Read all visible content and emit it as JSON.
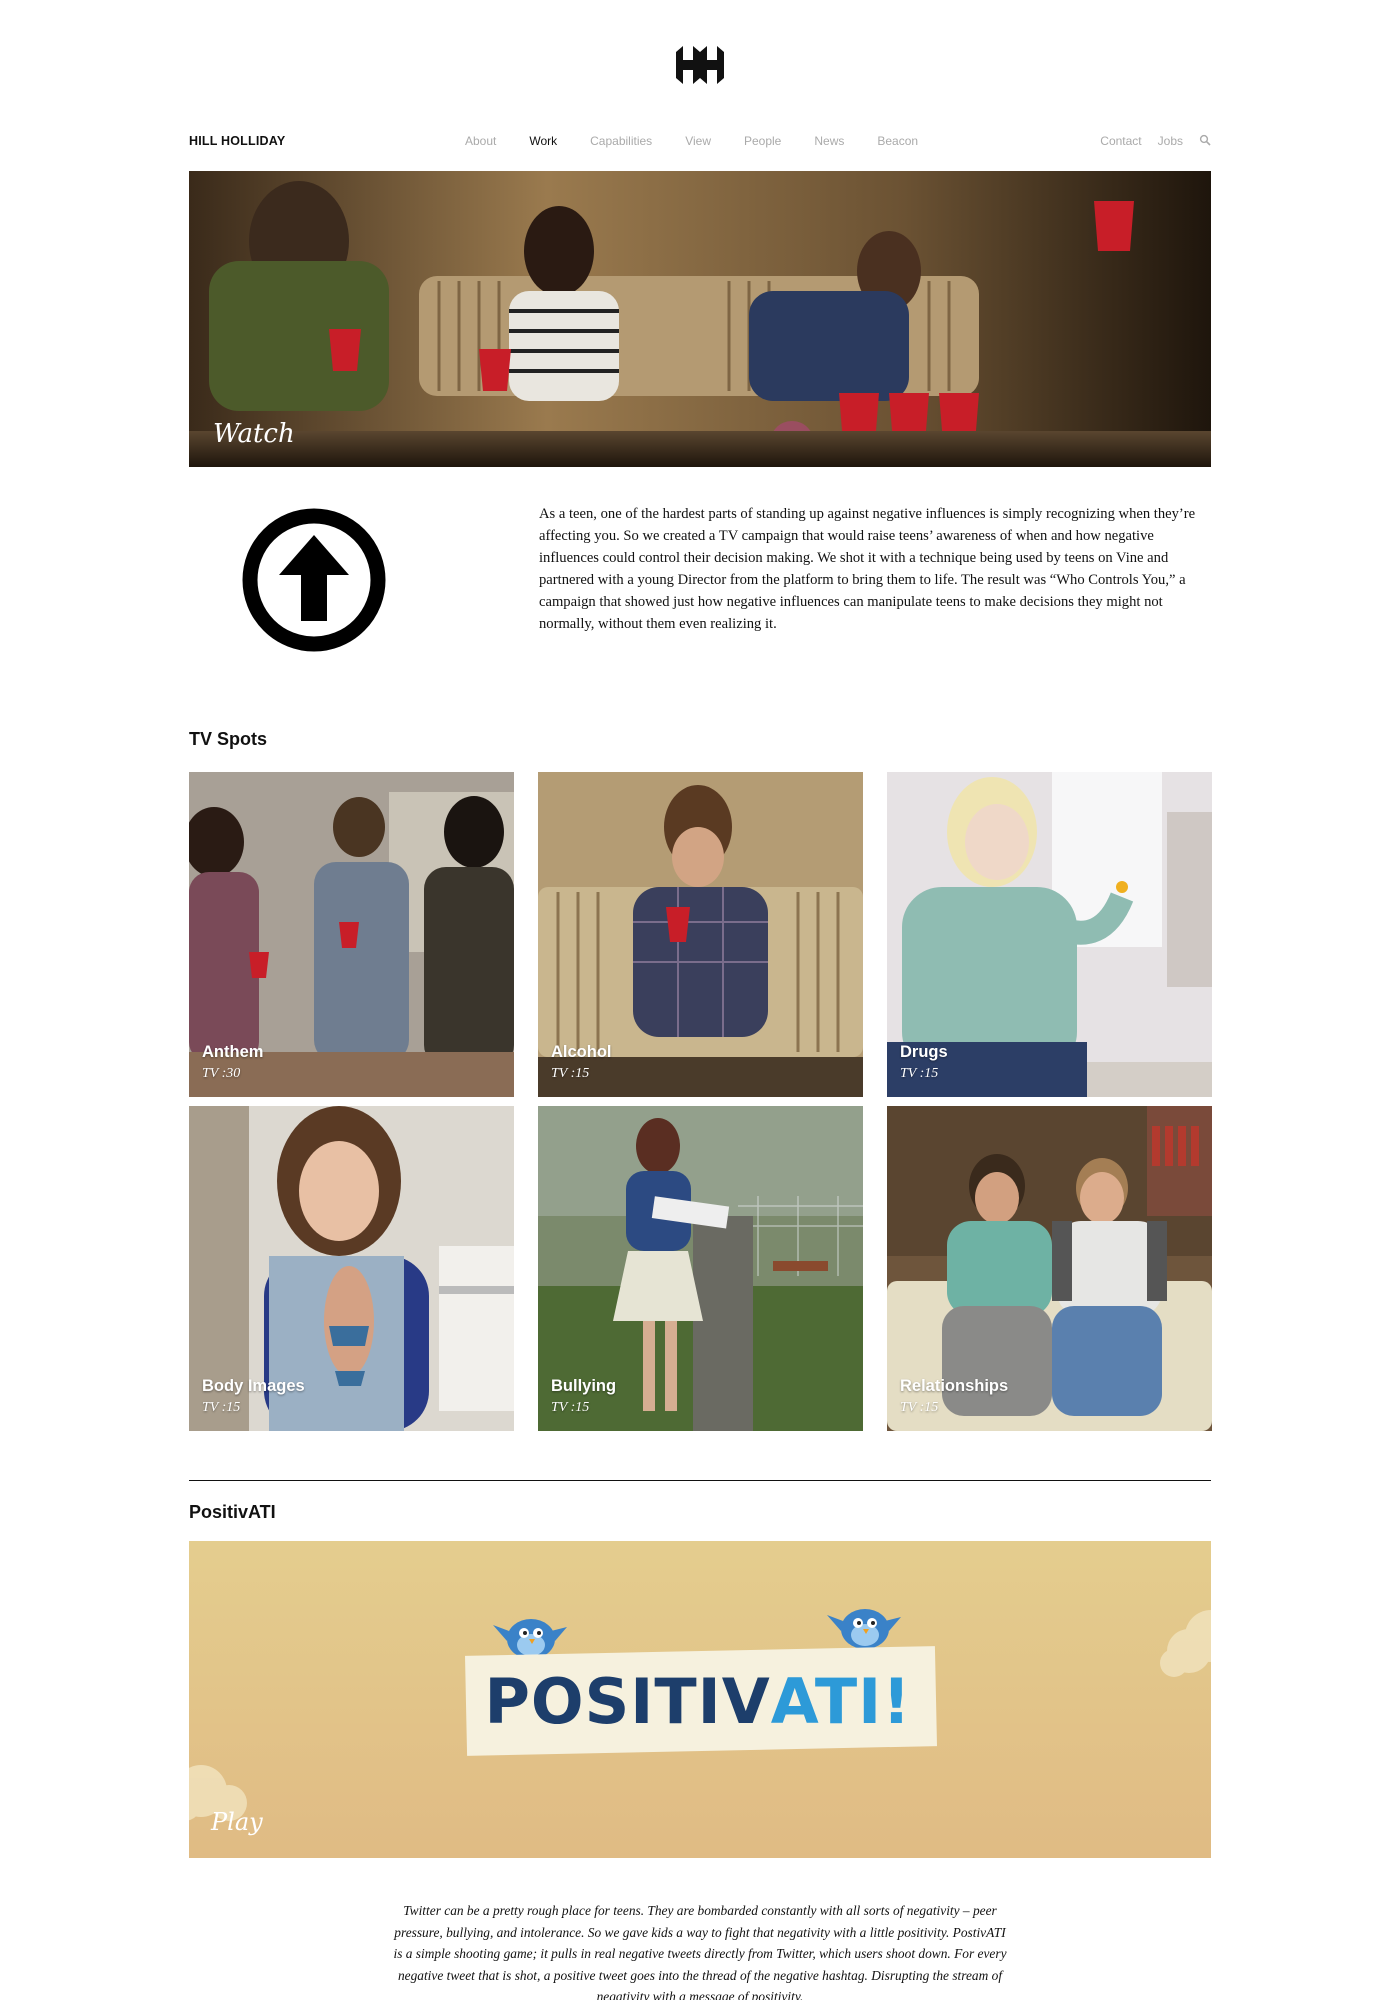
{
  "header": {
    "logo_icon": "hh-monogram-logo",
    "brand": "HILL HOLLIDAY",
    "nav_items": [
      "About",
      "Work",
      "Capabilities",
      "View",
      "People",
      "News",
      "Beacon"
    ],
    "active_nav": "Work",
    "right_links": [
      "Contact",
      "Jobs"
    ],
    "search_icon": "search-icon"
  },
  "hero": {
    "label": "Watch"
  },
  "intro": {
    "icon": "arrow-up-circle-icon",
    "text": "As a teen, one of the hardest parts of standing up against negative influences is simply recognizing when they’re affecting you. So we created a TV campaign that would raise teens’ awareness of when and how negative influences could control their decision making. We shot it with a technique being used by teens on Vine and partnered with a young Director from the platform to bring them to life. The result was “Who Controls You,” a campaign that showed just how negative influences can manipulate teens to make decisions they might not normally, without them even realizing it."
  },
  "tv_spots": {
    "title": "TV Spots",
    "items": [
      {
        "title": "Anthem",
        "subtitle": "TV :30"
      },
      {
        "title": "Alcohol",
        "subtitle": "TV :15"
      },
      {
        "title": "Drugs",
        "subtitle": "TV :15"
      },
      {
        "title": "Body Images",
        "subtitle": "TV :15"
      },
      {
        "title": "Bullying",
        "subtitle": "TV :15"
      },
      {
        "title": "Relationships",
        "subtitle": "TV :15"
      }
    ]
  },
  "positivati": {
    "title": "PositivATI",
    "logo_text_a": "POSITIV",
    "logo_text_b": "ATI!",
    "play_label": "Play",
    "text": "Twitter can be a pretty rough place for teens. They are bombarded constantly with all sorts of negativity – peer pressure, bullying, and intolerance. So we gave kids a way to fight that negativity with a little positivity. PostivATI is a simple shooting game; it pulls in real negative tweets directly from Twitter, which users shoot down. For every negative tweet that is shot, a positive tweet goes into the thread of the negative hashtag. Disrupting the stream of negativity with a message of positivity."
  },
  "colors": {
    "text": "#111111",
    "nav_inactive": "#aaaaaa",
    "posi_bg": "#e3c48c",
    "posi_navy": "#1d3e6b",
    "posi_blue": "#2d9ad8"
  }
}
